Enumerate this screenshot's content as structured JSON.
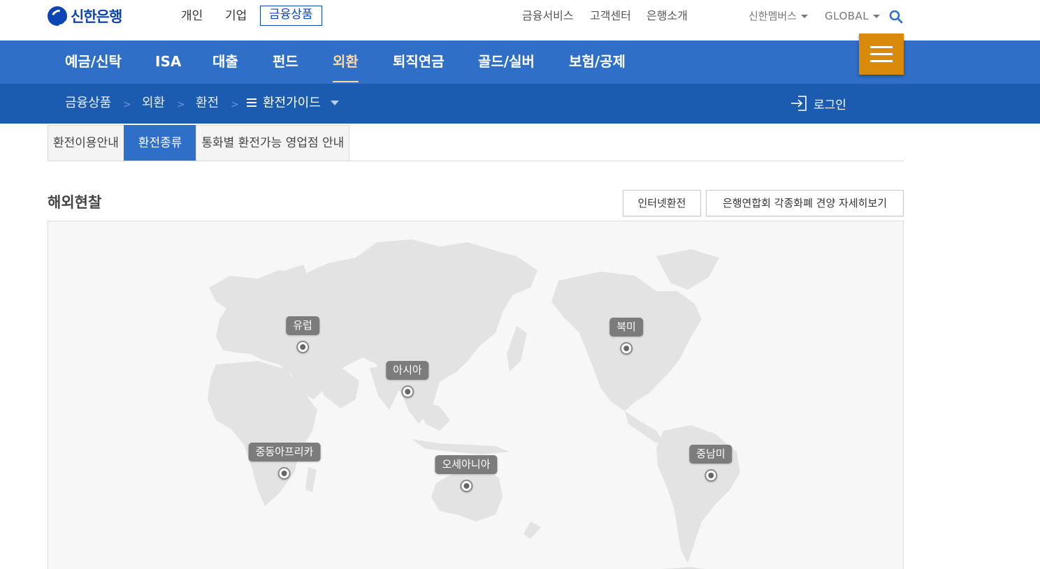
{
  "brand": {
    "name": "신한은행"
  },
  "customer_tabs": [
    "개인",
    "기업",
    "금융상품"
  ],
  "util_links": [
    "금융서비스",
    "고객센터",
    "은행소개"
  ],
  "util_dropdowns": [
    "신한멤버스",
    "GLOBAL"
  ],
  "main_nav": [
    "예금/신탁",
    "ISA",
    "대출",
    "펀드",
    "외환",
    "퇴직연금",
    "골드/실버",
    "보험/공제"
  ],
  "breadcrumb": [
    "금융상품",
    "외환",
    "환전",
    "환전가이드"
  ],
  "login_label": "로그인",
  "sub_tabs": [
    "환전이용안내",
    "환전종류",
    "통화별 환전가능 영업점 안내"
  ],
  "section": {
    "title": "해외현찰",
    "buttons": [
      "인터넷환전",
      "은행연합회 각종화폐 견양 자세히보기"
    ]
  },
  "regions": [
    "유럽",
    "아시아",
    "북미",
    "중동아프리카",
    "오세아니아",
    "중남미"
  ],
  "colors": {
    "brand": "#0b46b4",
    "nav": "#2f6fc7",
    "crumb": "#1c5cb0",
    "accent": "#d98a0a",
    "active_nav": "#ffd99a"
  },
  "icons": [
    "search-icon",
    "menu-icon",
    "list-icon",
    "login-icon",
    "caret-down-icon",
    "pin-icon"
  ]
}
